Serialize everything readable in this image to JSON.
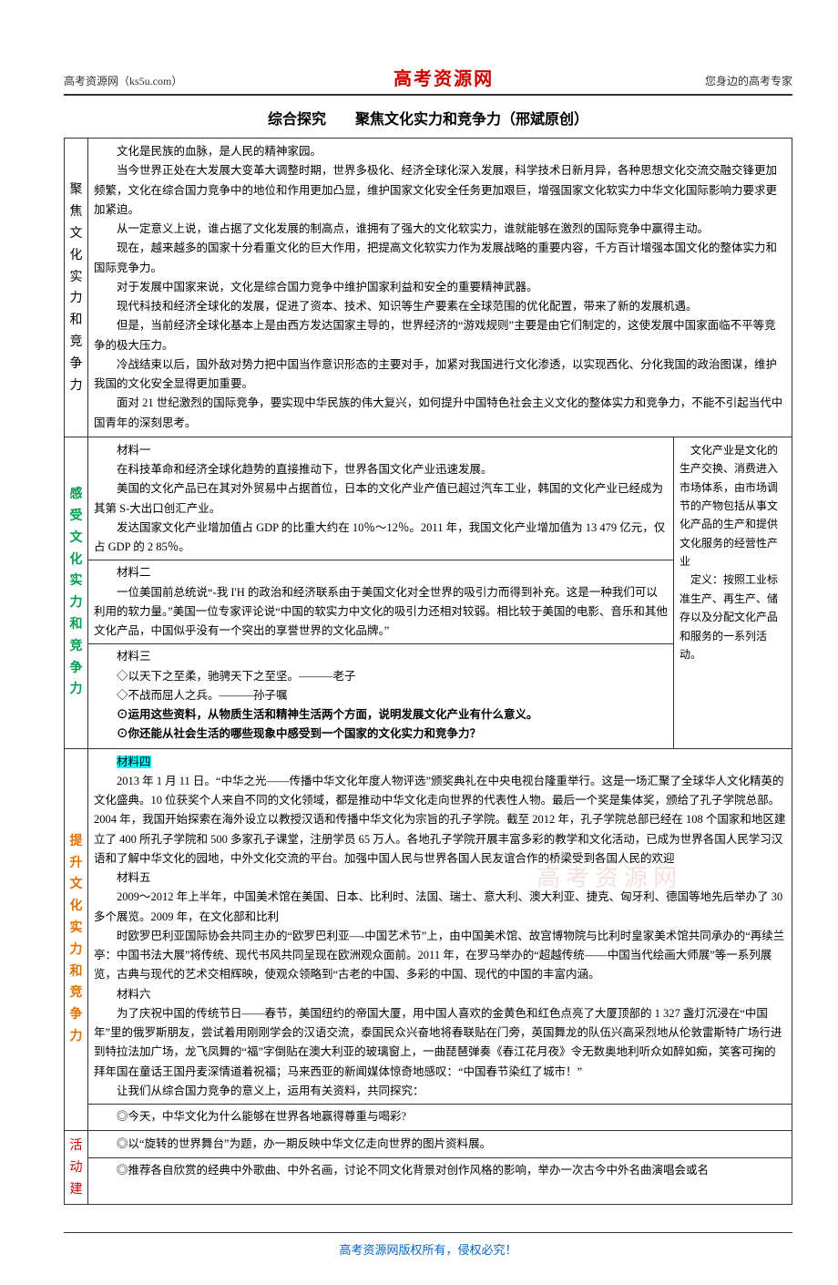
{
  "header": {
    "left": "高考资源网（ks5u.com）",
    "center": "高考资源网",
    "right": "您身边的高考专家"
  },
  "title": "综合探究　　聚焦文化实力和竞争力（邢斌原创）",
  "section1": {
    "label": "聚焦文化实力和竞争力",
    "paras": [
      "文化是民族的血脉，是人民的精神家园。",
      "当今世界正处在大发展大变革大调整时期，世界多极化、经济全球化深入发展，科学技术日新月异，各种思想文化交流交融交锋更加频繁，文化在综合国力竞争中的地位和作用更加凸显，维护国家文化安全任务更加艰巨，增强国家文化软实力中华文化国际影响力要求更加紧迫。",
      "从一定意义上说，谁占据了文化发展的制高点，谁拥有了强大的文化软实力，谁就能够在激烈的国际竞争中赢得主动。",
      "现在，越来越多的国家十分看重文化的巨大作用，把提高文化软实力作为发展战略的重要内容，千方百计增强本国文化的整体实力和国际竞争力。",
      "对于发展中国家来说，文化是综合国力竞争中维护国家利益和安全的重要精神武器。",
      "现代科技和经济全球化的发展，促进了资本、技术、知识等生产要素在全球范围的优化配置，带来了新的发展机遇。",
      "但是，当前经济全球化基本上是由西方发达国家主导的，世界经济的“游戏规则”主要是由它们制定的，这使发展中国家面临不平等竞争的极大压力。",
      "冷战结束以后，国外敌对势力把中国当作意识形态的主要对手，加紧对我国进行文化渗透，以实现西化、分化我国的政治图谋，维护我国的文化安全显得更加重要。",
      "面对 21 世纪激烈的国际竞争，要实现中华民族的伟大复兴，如何提升中国特色社会主义文化的整体实力和竞争力，不能不引起当代中国青年的深刻思考。"
    ]
  },
  "section2": {
    "label": "感受文化实力和竞争力",
    "m1_title": "材料一",
    "m1_paras": [
      "在科技革命和经济全球化趋势的直接推动下，世界各国文化产业迅速发展。",
      "美国的文化产品已在其对外贸易中占据首位，日本的文化产业产值已超过汽车工业，韩国的文化产业已经成为其第 S-大出口创汇产业。",
      "发达国家文化产业增加值占 GDP 的比重大约在 10％～12％。2011 年，我国文化产业增加值为 13 479 亿元，仅占 GDP 的 2 85％。"
    ],
    "m2_title": "材料二",
    "m2_paras": [
      "一位美国前总统说“-我 I'H 的政治和经济联系由于美国文化对全世界的吸引力而得到补充。这是一种我们可以利用的软力量。”美国一位专家评论说“中国的软实力中文化的吸引力还相对较弱。相比较于美国的电影、音乐和其他文化产品，中国似乎没有一个突出的享誉世界的文化品牌。”"
    ],
    "m3_title": "材料三",
    "m3_lines": [
      "◇以天下之至柔，驰骋天下之至坚。———老子",
      "◇不战而屈人之兵。———孙子嘱"
    ],
    "q1": "⊙运用这些资料，从物质生活和精神生活两个方面，说明发展文化产业有什么意义。",
    "q2": "⊙你还能从社会生活的哪些现象中感受到一个国家的文化实力和竞争力？",
    "side_paras": [
      "文化产业是文化的生产交换、消费进入市场体系，由市场调节的产物包括从事文化产品的生产和提供文化服务的经营性产业",
      "定义：按照工业标准生产、再生产、储存以及分配文化产品和服务的一系列活动。"
    ]
  },
  "section3": {
    "label": "提升文化实力和竞争力",
    "m4_title": "材料四",
    "m4_paras": [
      "2013 年 1 月 11 日。“中华之光——传播中华文化年度人物评选”颁奖典礼在中央电视台隆重举行。这是一场汇聚了全球华人文化精英的文化盛典。10 位获奖个人来自不同的文化领域，都是推动中华文化走向世界的代表性人物。最后一个奖是集体奖，颁给了孔子学院总部。2004 年，我国开始探索在海外设立以教授汉语和传播中华文化为宗旨的孔子学院。截至 2012 年，孔子学院总部已经在 108 个国家和地区建立了 400 所孔子学院和 500 多家孔子课堂，注册学员 65 万人。各地孔子学院开展丰富多彩的教学和文化活动，已成为世界各国人民学习汉语和了解中华文化的园地，中外文化交流的平台。加强中国人民与世界各国人民友谊合作的桥梁受到各国人民的欢迎"
    ],
    "m5_title": "材料五",
    "m5_paras": [
      "2009～2012 年上半年，中国美术馆在美国、日本、比利时、法国、瑞士、意大利、澳大利亚、捷克、匈牙利、德国等地先后举办了 30 多个展览。2009 年，在文化部和比利",
      "时欧罗巴利亚国际协会共同主办的“欧罗巴利亚—-中国艺术节”上，由中国美术馆、故宫博物院与比利时皇家美术馆共同承办的“再续兰亭：中国书法大展”将传统、现代书风共同呈现在欧洲观众面前。2011 年，在罗马举办的“超越传统——中国当代绘画大师展”等一系列展览，古典与现代的艺术交相辉映，使观众领略到“古老的中国、多彩的中国、现代的中国的丰富内涵。"
    ],
    "m6_title": "材料六",
    "m6_paras": [
      "为了庆祝中国的传统节日——春节，美国纽约的帝国大厦，用中国人喜欢的金黄色和红色点亮了大厦顶部的 1 327 盏灯沉浸在“中国年”里的俄罗斯朋友，尝试着用刚刚学会的汉语交流，泰国民众兴奋地将春联贴在门旁，英国舞龙的队伍兴高采烈地从伦敦雷斯特广场行进到特拉法加广场，龙飞凤舞的“福”字倒贴在澳大利亚的玻璃窗上，一曲琵琶弹奏《春江花月夜》令无数奥地利听众如醉如痴，笑客可掬的拜年国在童话王国丹麦深情道着祝福；马来西亚的新闻媒体惊奇地感叹：“中国春节染红了城市！”"
    ],
    "discuss": "让我们从综合国力竞争的意义上，运用有关资料，共同探究：",
    "q3": "◎今天，中华文化为什么能够在世界各地赢得尊重与喝彩?"
  },
  "section4": {
    "label": "活动建",
    "lines": [
      "◎以“旋转的世界舞台”为题，办一期反映中华文亿走向世界的图片资料展。",
      "◎推荐各自欣赏的经典中外歌曲、中外名画，讨论不同文化背景对创作风格的影响，举办一次古今中外名曲演唱会或名"
    ]
  },
  "footer": "高考资源网版权所有，侵权必究！",
  "watermark": "高考资源网"
}
